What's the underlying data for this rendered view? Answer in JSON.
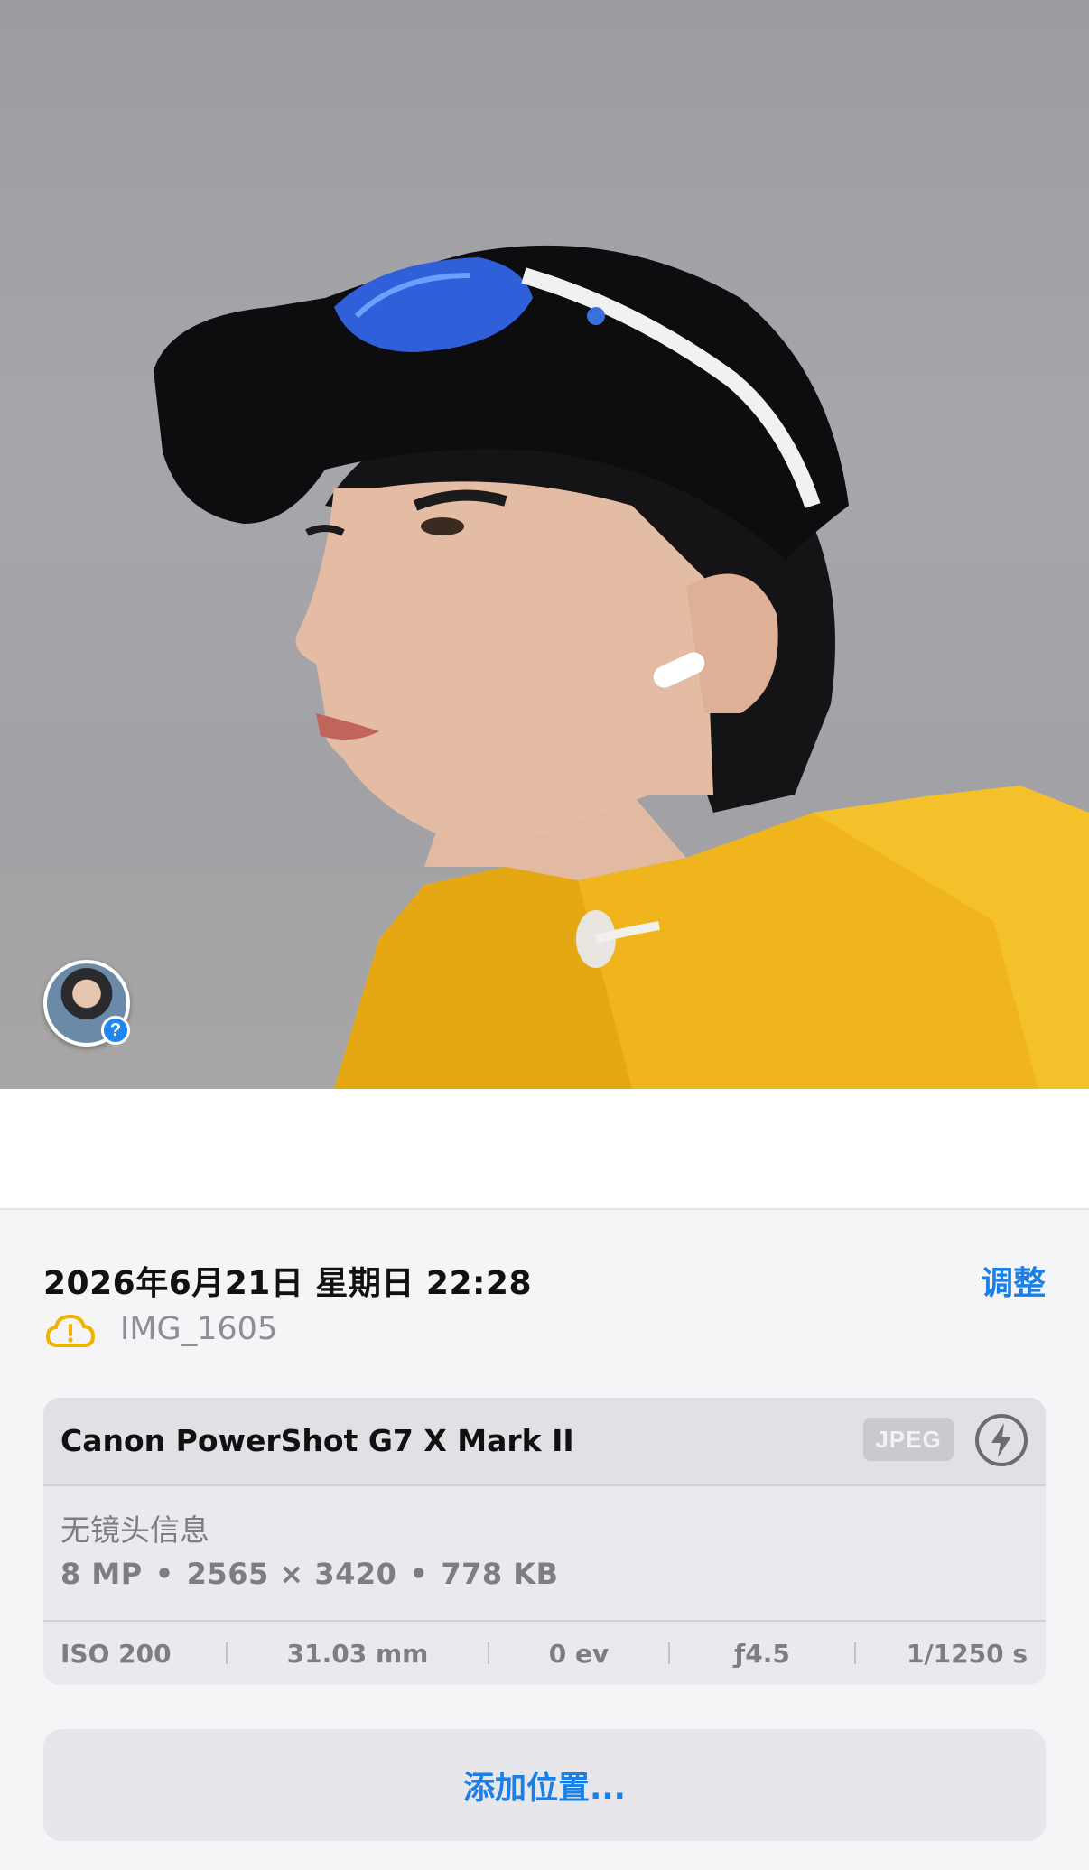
{
  "photo": {
    "subject_icon": "person-portrait",
    "person_badge_icon": "person-avatar",
    "person_badge_mark": "?"
  },
  "info": {
    "date": "2026年6月21日 星期日 22:28",
    "adjust_label": "调整",
    "filename": "IMG_1605",
    "cloud_icon": "cloud-warning-icon"
  },
  "camera": {
    "model": "Canon PowerShot G7 X Mark II",
    "format_badge": "JPEG",
    "flash_icon": "flash-icon",
    "lens": "无镜头信息",
    "megapixels": "8 MP",
    "resolution": "2565 × 3420",
    "size": "778 KB",
    "dot": "•",
    "exif": {
      "iso": "ISO 200",
      "focal": "31.03 mm",
      "ev": "0 ev",
      "aperture": "ƒ4.5",
      "shutter": "1/1250 s"
    }
  },
  "location": {
    "add_label": "添加位置..."
  },
  "colors": {
    "accent": "#1a7fe6",
    "warning": "#f0b400",
    "jacket": "#f0b51c"
  }
}
